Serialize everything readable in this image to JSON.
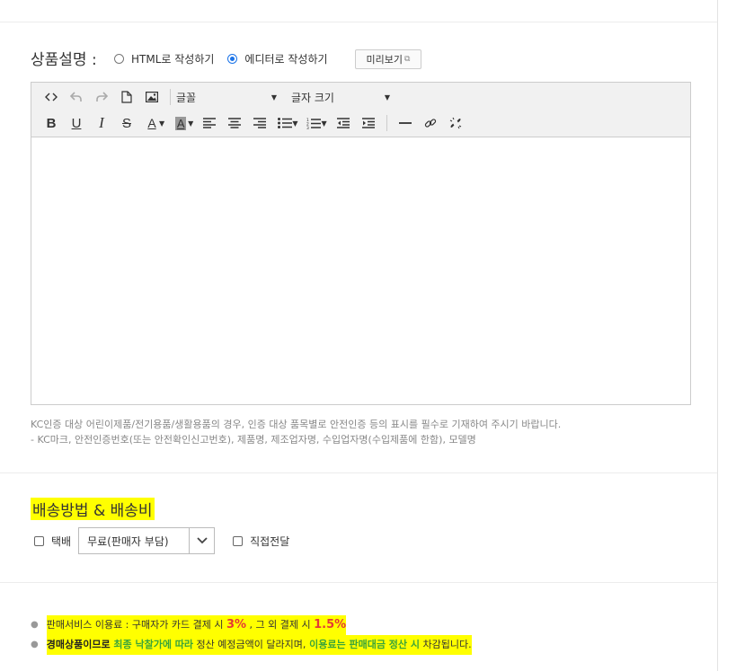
{
  "description": {
    "title": "상품설명 :",
    "option_html": "HTML로 작성하기",
    "option_editor": "에디터로 작성하기",
    "selected": "editor",
    "preview_button": "미리보기"
  },
  "editor": {
    "font_select": "글꼴",
    "size_select": "글자 크기",
    "tools_row1": [
      "code-view-icon",
      "undo-icon",
      "redo-icon",
      "new-document-icon",
      "image-icon"
    ],
    "tools_row2": [
      "bold-icon",
      "underline-icon",
      "italic-icon",
      "strikethrough-icon",
      "font-color-icon",
      "background-color-icon",
      "align-left-icon",
      "align-center-icon",
      "align-right-icon",
      "bulleted-list-icon",
      "numbered-list-icon",
      "outdent-icon",
      "indent-icon",
      "horizontal-rule-icon",
      "link-icon",
      "unlink-icon"
    ],
    "body": ""
  },
  "notice": {
    "line1": "KC인증 대상 어린이제품/전기용품/생활용품의 경우, 인증 대상 품목별로 안전인증 등의 표시를 필수로 기재하여 주시기 바랍니다.",
    "line2": "- KC마크, 안전인증번호(또는 안전확인신고번호), 제품명, 제조업자명, 수입업자명(수입제품에 한함), 모델명"
  },
  "shipping": {
    "title": "배송방법 & 배송비",
    "courier_label": "택배",
    "courier_checked": false,
    "fee_option": "무료(판매자 부담)",
    "direct_label": "직접전달",
    "direct_checked": false
  },
  "fees": {
    "line1_prefix": "판매서비스 이용료 : 구매자가 카드 결제 시 ",
    "line1_card_rate": "3%",
    "line1_mid": " , 그 외 결제 시 ",
    "line1_other_rate": "1.5%",
    "line2_part1": "경매상품이므로",
    "line2_part2": " 최종 낙찰가에 따라",
    "line2_part3": " 정산 예정금액이 달라지며,",
    "line2_part4": " 이용료는 판매대금 정산 시",
    "line2_part5": " 차감됩니다."
  },
  "colors": {
    "highlight": "#ffff00",
    "radio_selected": "#1a73e8",
    "rate_red": "#e53935",
    "emphasis_green": "#3aa53a"
  }
}
